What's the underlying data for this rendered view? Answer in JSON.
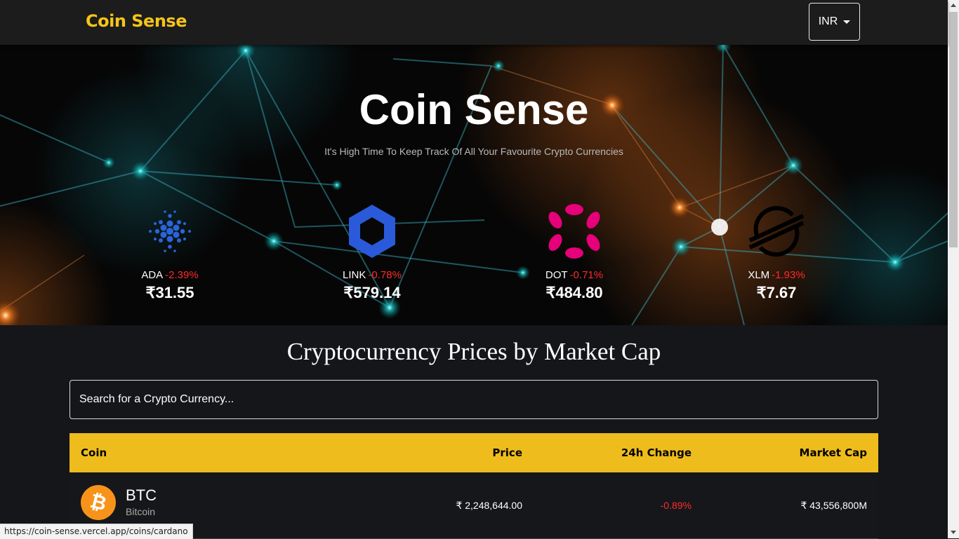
{
  "header": {
    "brand": "Coin Sense",
    "currency": "INR"
  },
  "hero": {
    "title": "Coin Sense",
    "subtitle": "It's High Time To Keep Track Of All Your Favourite Crypto Currencies",
    "coins": [
      {
        "symbol": "ADA",
        "change": "-2.39%",
        "price": "₹31.55",
        "icon": "cardano-icon"
      },
      {
        "symbol": "LINK",
        "change": "-0.78%",
        "price": "₹579.14",
        "icon": "chainlink-icon"
      },
      {
        "symbol": "DOT",
        "change": "-0.71%",
        "price": "₹484.80",
        "icon": "polkadot-icon"
      },
      {
        "symbol": "XLM",
        "change": "-1.93%",
        "price": "₹7.67",
        "icon": "stellar-icon"
      }
    ]
  },
  "main": {
    "title": "Cryptocurrency Prices by Market Cap",
    "search_placeholder": "Search for a Crypto Currency...",
    "table": {
      "headers": {
        "coin": "Coin",
        "price": "Price",
        "change": "24h Change",
        "market_cap": "Market Cap"
      },
      "rows": [
        {
          "symbol": "BTC",
          "name": "Bitcoin",
          "price": "₹ 2,248,644.00",
          "change": "-0.89%",
          "market_cap": "₹ 43,556,800M",
          "icon": "bitcoin-icon"
        }
      ]
    }
  },
  "status_bar": {
    "url": "https://coin-sense.vercel.app/coins/cardano"
  },
  "colors": {
    "accent": "#eebc1d",
    "brand": "#f5c518",
    "negative": "#ff2b2b",
    "background": "#14161a"
  }
}
